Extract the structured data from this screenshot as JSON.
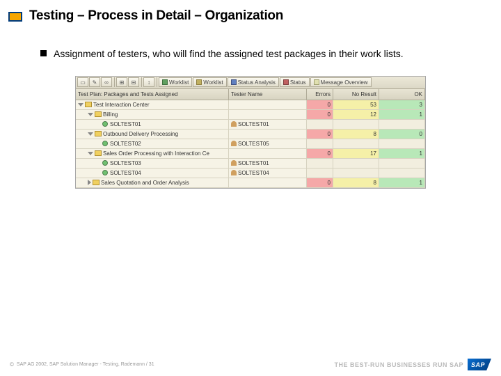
{
  "slide": {
    "title": "Testing – Process in Detail – Organization",
    "bullet": "Assignment of testers, who will find the assigned test packages in their work lists."
  },
  "toolbar": {
    "worklist": "Worklist",
    "worklist2": "Worklist",
    "status_analysis": "Status Analysis",
    "status": "Status",
    "message_overview": "Message Overview"
  },
  "columns": {
    "c1": "Test Plan: Packages and Tests Assigned",
    "c2": "Tester Name",
    "c3": "Errors",
    "c4": "No Result",
    "c5": "OK"
  },
  "rows": [
    {
      "indent": 0,
      "expand": "open",
      "label": "Test Interaction Center",
      "tester": "",
      "errors": "0",
      "noresult": "53",
      "ok": "3",
      "colors": [
        "red",
        "yel",
        "grn"
      ]
    },
    {
      "indent": 1,
      "expand": "open",
      "label": "Billing",
      "tester": "",
      "errors": "0",
      "noresult": "12",
      "ok": "1",
      "colors": [
        "red",
        "yel",
        "grn"
      ]
    },
    {
      "indent": 2,
      "expand": "",
      "label": "SOLTEST01",
      "tester": "SOLTEST01",
      "errors": "",
      "noresult": "",
      "ok": "",
      "colors": [
        "",
        "",
        ""
      ]
    },
    {
      "indent": 1,
      "expand": "open",
      "label": "Outbound Delivery Processing",
      "tester": "",
      "errors": "0",
      "noresult": "8",
      "ok": "0",
      "colors": [
        "red",
        "yel",
        "grn"
      ]
    },
    {
      "indent": 2,
      "expand": "",
      "label": "SOLTEST02",
      "tester": "SOLTEST05",
      "errors": "",
      "noresult": "",
      "ok": "",
      "colors": [
        "",
        "",
        ""
      ]
    },
    {
      "indent": 1,
      "expand": "open",
      "label": "Sales Order Processing with Interaction Ce",
      "tester": "",
      "errors": "0",
      "noresult": "17",
      "ok": "1",
      "colors": [
        "red",
        "yel",
        "grn"
      ]
    },
    {
      "indent": 2,
      "expand": "",
      "label": "SOLTEST03",
      "tester": "SOLTEST01",
      "errors": "",
      "noresult": "",
      "ok": "",
      "colors": [
        "",
        "",
        ""
      ]
    },
    {
      "indent": 2,
      "expand": "",
      "label": "SOLTEST04",
      "tester": "SOLTEST04",
      "errors": "",
      "noresult": "",
      "ok": "",
      "colors": [
        "",
        "",
        ""
      ]
    },
    {
      "indent": 1,
      "expand": "closed",
      "label": "Sales Quotation and Order Analysis",
      "tester": "",
      "errors": "0",
      "noresult": "8",
      "ok": "1",
      "colors": [
        "red",
        "yel",
        "grn"
      ]
    }
  ],
  "footer": {
    "copyright": "SAP AG 2002, SAP Solution Manager - Testing, Rademann / 31",
    "tagline": "THE BEST-RUN BUSINESSES RUN SAP",
    "logo": "SAP"
  }
}
